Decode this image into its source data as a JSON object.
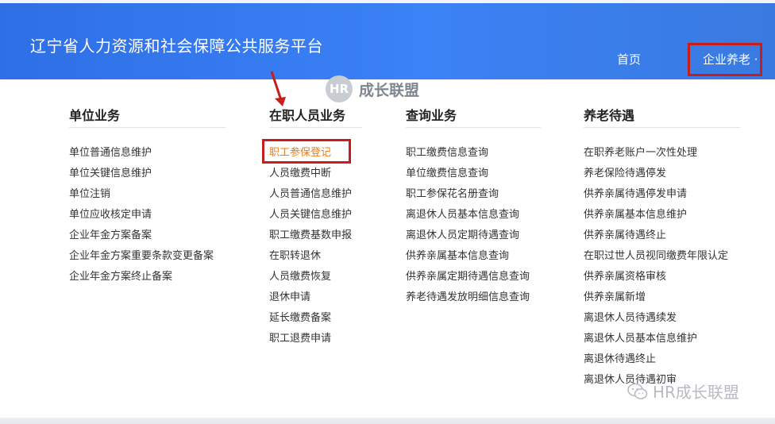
{
  "header": {
    "title": "辽宁省人力资源和社会保障公共服务平台",
    "nav": {
      "home": "首页",
      "active_menu": "企业养老 ·"
    }
  },
  "watermark": {
    "badge": "HR",
    "text": "成长联盟",
    "bottom_text": "HR成长联盟"
  },
  "columns": [
    {
      "heading": "单位业务",
      "items": [
        "单位普通信息维护",
        "单位关键信息维护",
        "单位注销",
        "单位应收核定申请",
        "企业年金方案备案",
        "企业年金方案重要条款变更备案",
        "企业年金方案终止备案"
      ]
    },
    {
      "heading": "在职人员业务",
      "items": [
        "职工参保登记",
        "人员缴费中断",
        "人员普通信息维护",
        "人员关键信息维护",
        "职工缴费基数申报",
        "在职转退休",
        "人员缴费恢复",
        "退休申请",
        "延长缴费备案",
        "职工退费申请"
      ]
    },
    {
      "heading": "查询业务",
      "items": [
        "职工缴费信息查询",
        "单位缴费信息查询",
        "职工参保花名册查询",
        "离退休人员基本信息查询",
        "离退休人员定期待遇查询",
        "供养亲属基本信息查询",
        "供养亲属定期待遇信息查询",
        "养老待遇发放明细信息查询"
      ]
    },
    {
      "heading": "养老待遇",
      "items": [
        "在职养老账户一次性处理",
        "养老保险待遇停发",
        "供养亲属待遇停发申请",
        "供养亲属基本信息维护",
        "供养亲属待遇终止",
        "在职过世人员视同缴费年限认定",
        "供养亲属资格审核",
        "供养亲属新增",
        "离退休人员待遇续发",
        "离退休人员基本信息维护",
        "离退休待遇终止",
        "离退休人员待遇初审"
      ]
    }
  ],
  "colors": {
    "header_blue": "#3b82f6",
    "highlight_orange": "#ea7d1d",
    "annotation_red": "#c81d1d"
  }
}
